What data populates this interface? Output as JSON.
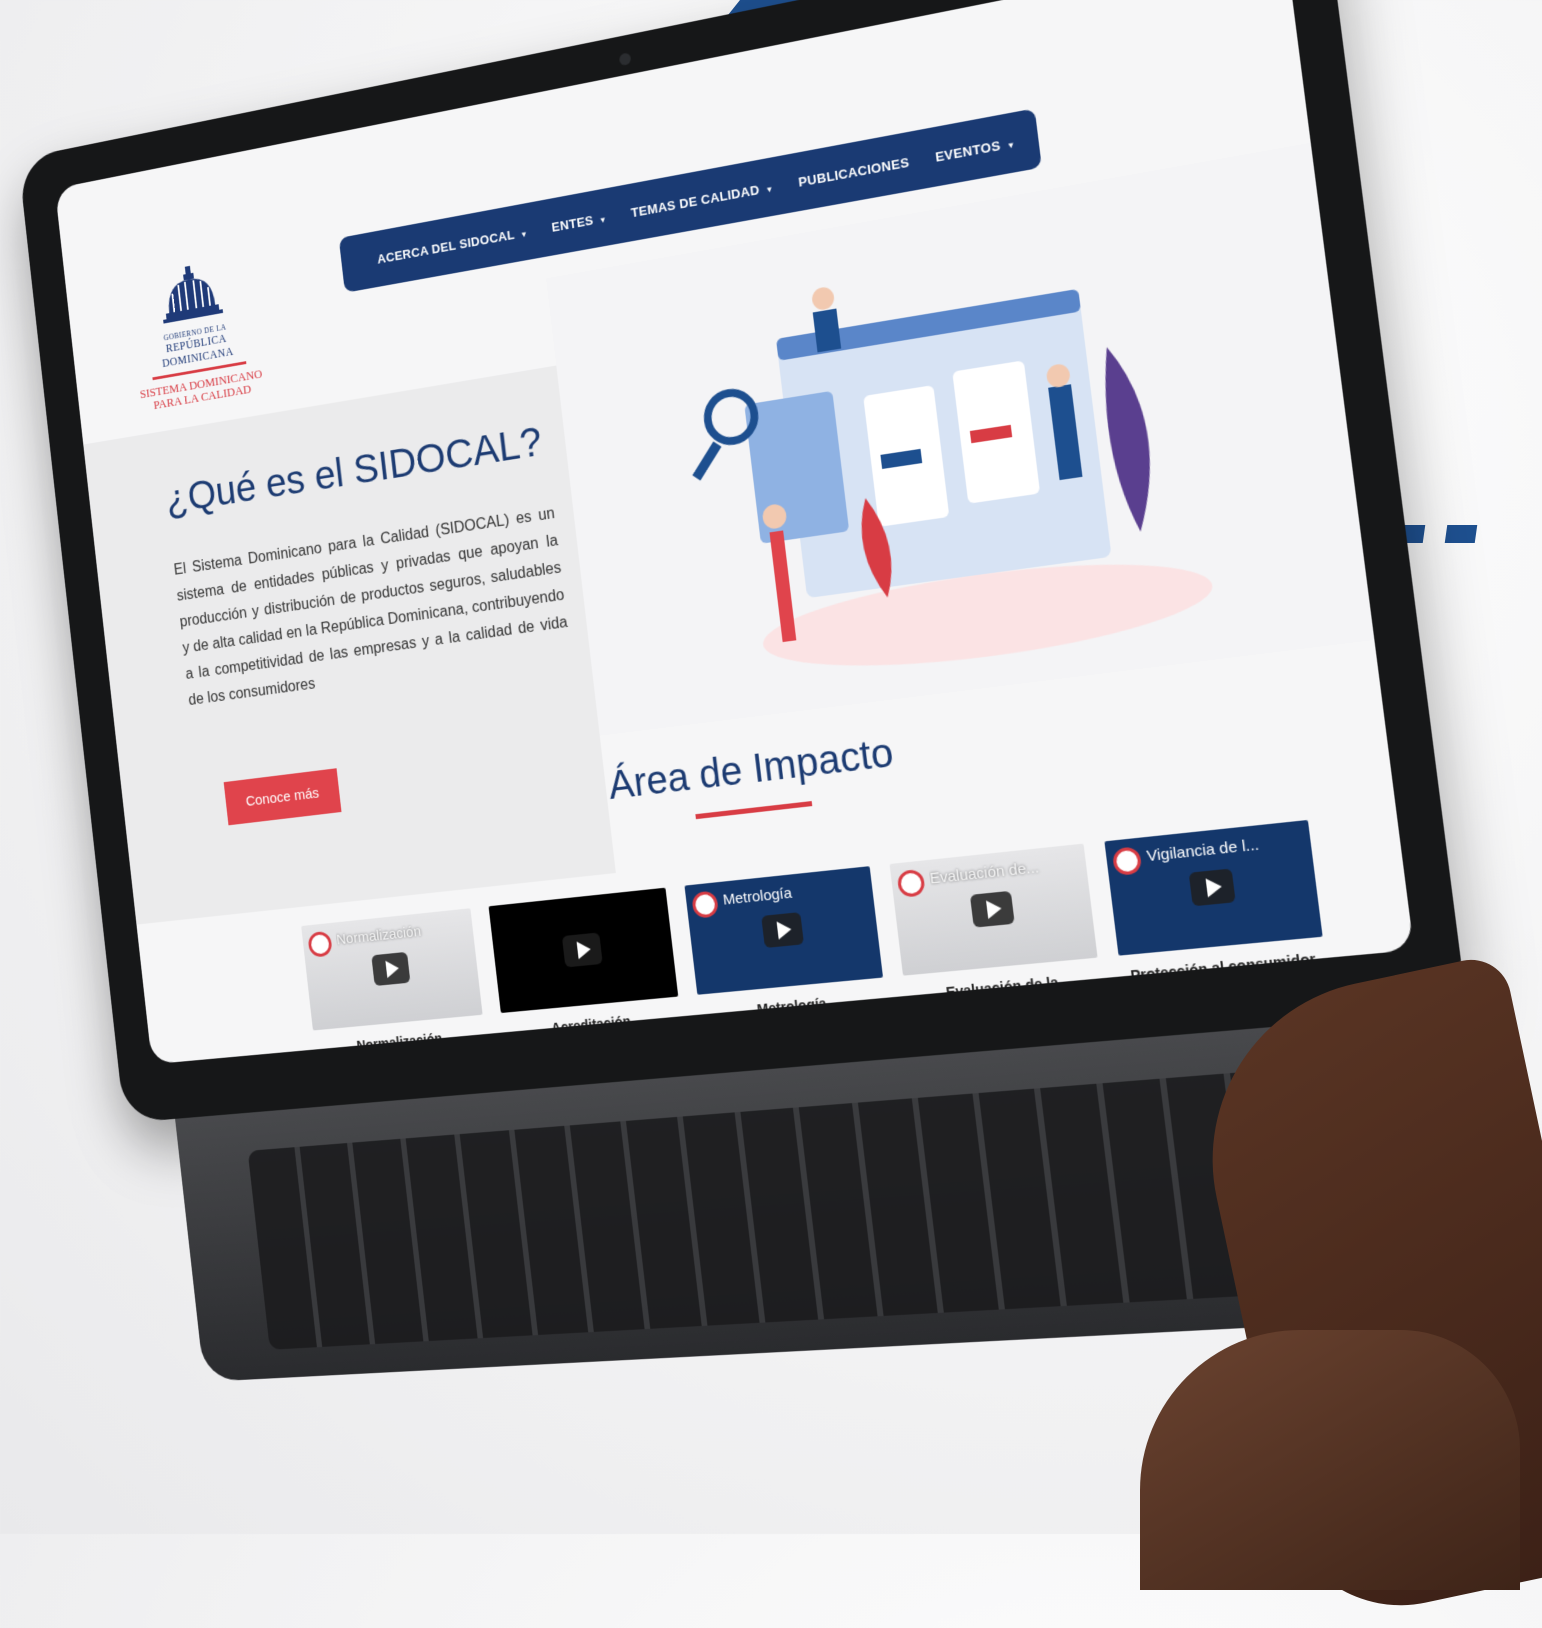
{
  "logo": {
    "gov_small": "GOBIERNO DE LA",
    "gov_main": "REPÚBLICA DOMINICANA",
    "org_line1": "SISTEMA DOMINICANO",
    "org_line2": "PARA LA CALIDAD"
  },
  "nav": {
    "items": [
      {
        "label": "ACERCA DEL SIDOCAL",
        "dropdown": true
      },
      {
        "label": "ENTES",
        "dropdown": true
      },
      {
        "label": "TEMAS DE CALIDAD",
        "dropdown": true
      },
      {
        "label": "PUBLICACIONES",
        "dropdown": false
      },
      {
        "label": "EVENTOS",
        "dropdown": true
      }
    ]
  },
  "hero": {
    "title": "¿Qué es el SIDOCAL?",
    "text": "El Sistema Dominicano para la Calidad (SIDOCAL) es un sistema de entidades públicas y privadas que apoyan la producción y distribución de productos seguros, saludables y de alta calidad en la República Dominicana, contribuyendo a la competitividad de las empresas y a la calidad de vida de los consumidores",
    "cta_label": "Conoce más"
  },
  "impact": {
    "title": "Área de Impacto",
    "cards": [
      {
        "video_title": "Normalización",
        "label": "Normalización"
      },
      {
        "video_title": "",
        "label": "Acreditación"
      },
      {
        "video_title": "Metrología",
        "label": "Metrología"
      },
      {
        "video_title": "Evaluación de...",
        "label": "Evaluación de la conformidad"
      },
      {
        "video_title": "Vigilancia de l...",
        "label": "Protección al consumidor"
      }
    ]
  },
  "colors": {
    "brand_navy": "#1a3a73",
    "brand_red": "#d83c44",
    "accent_blue": "#1d4f8f"
  },
  "icons": [
    "play-icon",
    "dome-logo-icon",
    "dropdown-caret-icon"
  ]
}
